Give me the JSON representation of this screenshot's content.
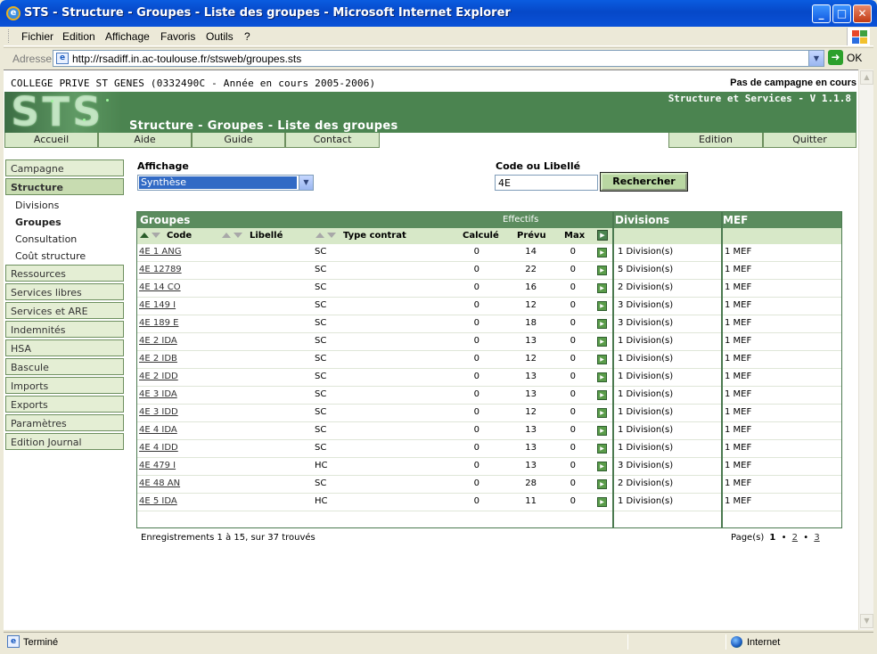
{
  "window": {
    "title": "STS - Structure - Groupes - Liste des groupes - Microsoft Internet Explorer",
    "menu": [
      "Fichier",
      "Edition",
      "Affichage",
      "Favoris",
      "Outils",
      "?"
    ],
    "address_label": "Adresse",
    "url": "http://rsadiff.in.ac-toulouse.fr/stsweb/groupes.sts",
    "go_label": "OK",
    "status_text": "Terminé",
    "zone_text": "Internet"
  },
  "header": {
    "college": "COLLEGE PRIVE ST GENES (0332490C - Année en cours 2005-2006)",
    "campagne": "Pas de campagne en cours",
    "version": "Structure et Services - V 1.1.8",
    "page_title": "Structure - Groupes - Liste des groupes",
    "logo_text": "STS"
  },
  "tabs": [
    "Accueil",
    "Aide",
    "Guide",
    "Contact",
    "Edition",
    "Quitter"
  ],
  "sidebar": {
    "campagne": "Campagne",
    "structure": "Structure",
    "subitems": [
      "Divisions",
      "Groupes",
      "Consultation",
      "Coût structure"
    ],
    "sections": [
      "Ressources",
      "Services libres",
      "Services et ARE",
      "Indemnités",
      "HSA",
      "Bascule",
      "Imports",
      "Exports",
      "Paramètres",
      "Edition Journal"
    ]
  },
  "filters": {
    "affichage_label": "Affichage",
    "affichage_value": "Synthèse",
    "code_label": "Code ou Libellé",
    "code_value": "4E",
    "search_button": "Rechercher"
  },
  "table": {
    "group_header": "Groupes",
    "effectifs_header": "Effectifs",
    "divisions_header": "Divisions",
    "mef_header": "MEF",
    "columns": [
      "Code",
      "Libellé",
      "Type contrat",
      "Calculé",
      "Prévu",
      "Max"
    ],
    "rows": [
      {
        "code": "4E 1 ANG",
        "type": "SC",
        "calc": "0",
        "prev": "14",
        "max": "0",
        "div": "1 Division(s)",
        "mef": "1 MEF"
      },
      {
        "code": "4E 12789",
        "type": "SC",
        "calc": "0",
        "prev": "22",
        "max": "0",
        "div": "5 Division(s)",
        "mef": "1 MEF"
      },
      {
        "code": "4E 14 CO",
        "type": "SC",
        "calc": "0",
        "prev": "16",
        "max": "0",
        "div": "2 Division(s)",
        "mef": "1 MEF"
      },
      {
        "code": "4E 149 I",
        "type": "SC",
        "calc": "0",
        "prev": "12",
        "max": "0",
        "div": "3 Division(s)",
        "mef": "1 MEF"
      },
      {
        "code": "4E 189 E",
        "type": "SC",
        "calc": "0",
        "prev": "18",
        "max": "0",
        "div": "3 Division(s)",
        "mef": "1 MEF"
      },
      {
        "code": "4E 2 IDA",
        "type": "SC",
        "calc": "0",
        "prev": "13",
        "max": "0",
        "div": "1 Division(s)",
        "mef": "1 MEF"
      },
      {
        "code": "4E 2 IDB",
        "type": "SC",
        "calc": "0",
        "prev": "12",
        "max": "0",
        "div": "1 Division(s)",
        "mef": "1 MEF"
      },
      {
        "code": "4E 2 IDD",
        "type": "SC",
        "calc": "0",
        "prev": "13",
        "max": "0",
        "div": "1 Division(s)",
        "mef": "1 MEF"
      },
      {
        "code": "4E 3 IDA",
        "type": "SC",
        "calc": "0",
        "prev": "13",
        "max": "0",
        "div": "1 Division(s)",
        "mef": "1 MEF"
      },
      {
        "code": "4E 3 IDD",
        "type": "SC",
        "calc": "0",
        "prev": "12",
        "max": "0",
        "div": "1 Division(s)",
        "mef": "1 MEF"
      },
      {
        "code": "4E 4 IDA",
        "type": "SC",
        "calc": "0",
        "prev": "13",
        "max": "0",
        "div": "1 Division(s)",
        "mef": "1 MEF"
      },
      {
        "code": "4E 4 IDD",
        "type": "SC",
        "calc": "0",
        "prev": "13",
        "max": "0",
        "div": "1 Division(s)",
        "mef": "1 MEF"
      },
      {
        "code": "4E 479 I",
        "type": "HC",
        "calc": "0",
        "prev": "13",
        "max": "0",
        "div": "3 Division(s)",
        "mef": "1 MEF"
      },
      {
        "code": "4E 48 AN",
        "type": "SC",
        "calc": "0",
        "prev": "28",
        "max": "0",
        "div": "2 Division(s)",
        "mef": "1 MEF"
      },
      {
        "code": "4E 5 IDA",
        "type": "HC",
        "calc": "0",
        "prev": "11",
        "max": "0",
        "div": "1 Division(s)",
        "mef": "1 MEF"
      }
    ]
  },
  "footer": {
    "records": "Enregistrements 1 à 15, sur 37 trouvés",
    "pages_label": "Page(s)",
    "pages": [
      "1",
      "2",
      "3"
    ],
    "bullet": "•"
  },
  "colors": {
    "banner_green": "#4b8450",
    "tab_green": "#d7e8c8",
    "xp_blue": "#0648c8"
  }
}
